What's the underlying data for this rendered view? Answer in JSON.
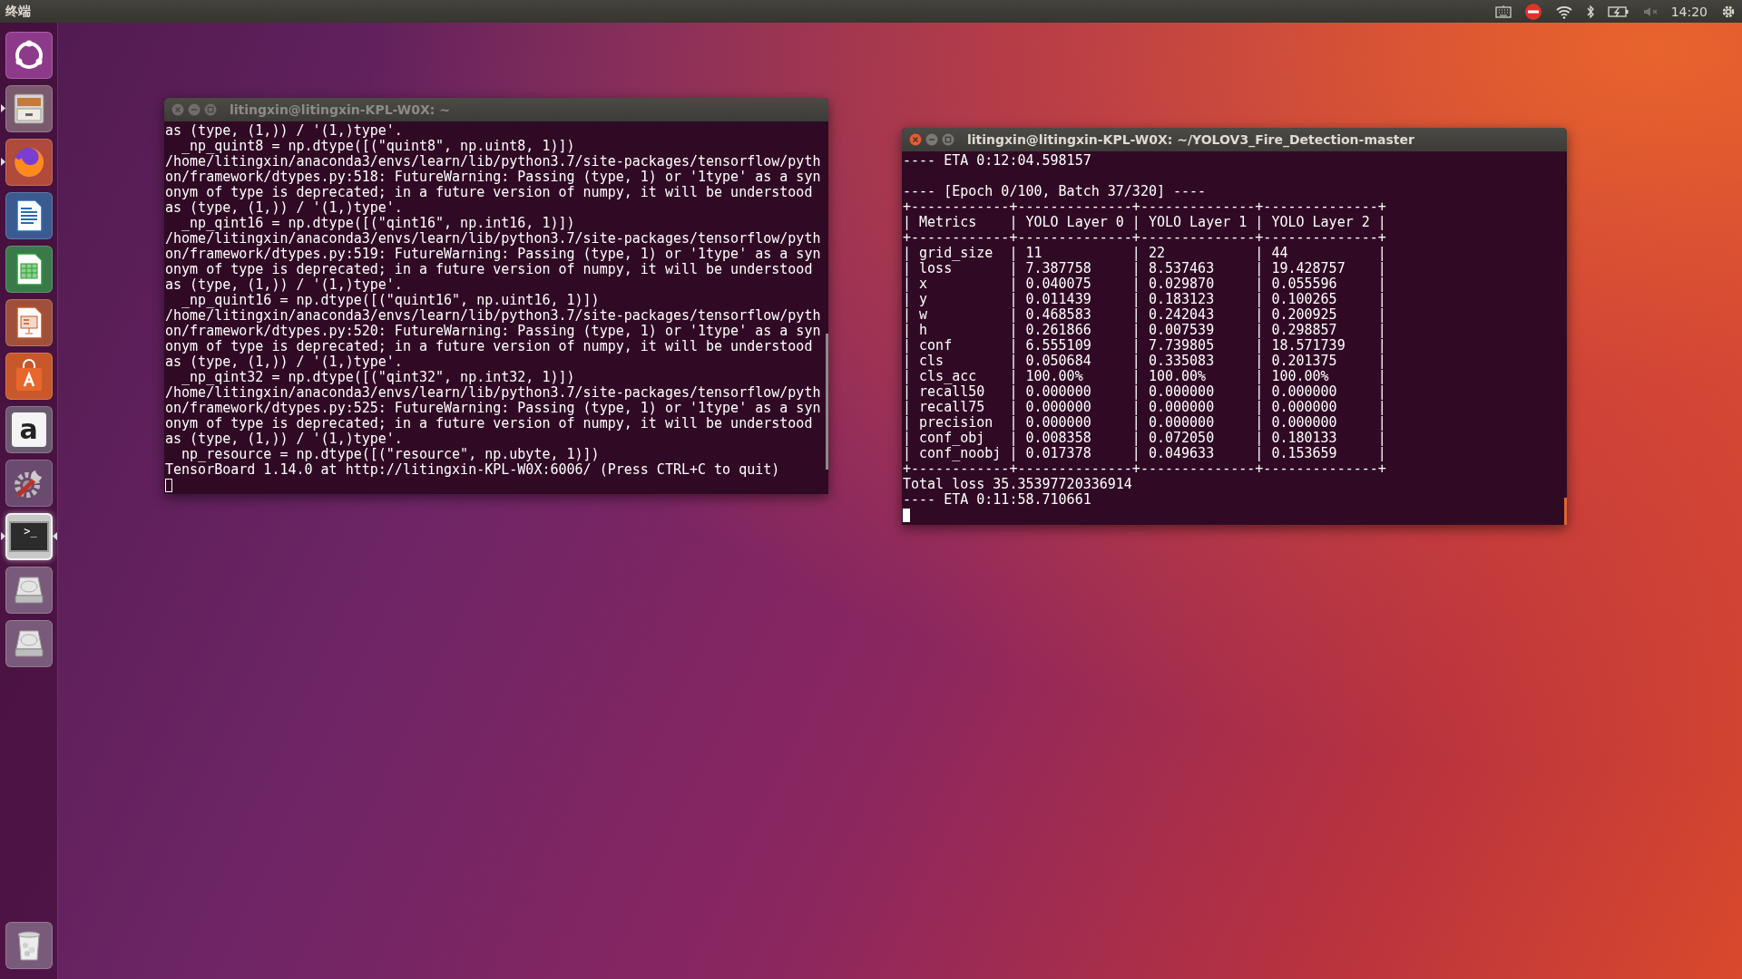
{
  "top_bar": {
    "app_title": "终端",
    "indicators": [
      {
        "kind": "keyboard"
      },
      {
        "kind": "alert"
      },
      {
        "kind": "wifi"
      },
      {
        "kind": "bluetooth"
      },
      {
        "kind": "battery"
      },
      {
        "kind": "volume-muted"
      }
    ],
    "clock": "14:20"
  },
  "launcher": {
    "items": [
      {
        "kind": "dash",
        "running": false,
        "focused": false
      },
      {
        "kind": "files",
        "running": true,
        "focused": false
      },
      {
        "kind": "browser",
        "running": true,
        "focused": false
      },
      {
        "kind": "writer",
        "running": false,
        "focused": false
      },
      {
        "kind": "calc",
        "running": false,
        "focused": false
      },
      {
        "kind": "impress",
        "running": false,
        "focused": false
      },
      {
        "kind": "software",
        "running": false,
        "focused": false
      },
      {
        "kind": "letter",
        "glyph": "a",
        "running": false,
        "focused": false
      },
      {
        "kind": "settings",
        "running": false,
        "focused": false
      },
      {
        "kind": "terminal",
        "glyph": ">_",
        "running": true,
        "focused": true
      },
      {
        "kind": "drive",
        "running": false,
        "focused": false
      },
      {
        "kind": "drive",
        "running": false,
        "focused": false
      }
    ],
    "trash": {
      "kind": "trash"
    }
  },
  "windows": [
    {
      "title": "litingxin@litingxin-KPL-W0X: ~",
      "active": false,
      "blocks": [
        [
          "as (type, (1,)) / '(1,)type'.",
          "  _np_quint8 = np.dtype([(\"quint8\", np.uint8, 1)])",
          "/home/litingxin/anaconda3/envs/learn/lib/python3.7/site-packages/tensorflow/pyth",
          "on/framework/dtypes.py:518: FutureWarning: Passing (type, 1) or '1type' as a syn",
          "onym of type is deprecated; in a future version of numpy, it will be understood",
          "as (type, (1,)) / '(1,)type'.",
          "  _np_qint16 = np.dtype([(\"qint16\", np.int16, 1)])",
          "/home/litingxin/anaconda3/envs/learn/lib/python3.7/site-packages/tensorflow/pyth",
          "on/framework/dtypes.py:519: FutureWarning: Passing (type, 1) or '1type' as a syn",
          "onym of type is deprecated; in a future version of numpy, it will be understood",
          "as (type, (1,)) / '(1,)type'.",
          "  _np_quint16 = np.dtype([(\"quint16\", np.uint16, 1)])",
          "/home/litingxin/anaconda3/envs/learn/lib/python3.7/site-packages/tensorflow/pyth",
          "on/framework/dtypes.py:520: FutureWarning: Passing (type, 1) or '1type' as a syn",
          "onym of type is deprecated; in a future version of numpy, it will be understood",
          "as (type, (1,)) / '(1,)type'.",
          "  _np_qint32 = np.dtype([(\"qint32\", np.int32, 1)])",
          "/home/litingxin/anaconda3/envs/learn/lib/python3.7/site-packages/tensorflow/pyth",
          "on/framework/dtypes.py:525: FutureWarning: Passing (type, 1) or '1type' as a syn",
          "onym of type is deprecated; in a future version of numpy, it will be understood",
          "as (type, (1,)) / '(1,)type'.",
          "  np_resource = np.dtype([(\"resource\", np.ubyte, 1)])",
          "TensorBoard 1.14.0 at http://litingxin-KPL-W0X:6006/ (Press CTRL+C to quit)"
        ]
      ]
    },
    {
      "title": "litingxin@litingxin-KPL-W0X: ~/YOLOV3_Fire_Detection-master",
      "active": true,
      "blocks": [
        [
          "---- ETA 0:12:04.598157"
        ],
        [
          "---- [Epoch 0/100, Batch 37/320] ----",
          "+------------+--------------+--------------+--------------+",
          "| Metrics    | YOLO Layer 0 | YOLO Layer 1 | YOLO Layer 2 |",
          "+------------+--------------+--------------+--------------+",
          "| grid_size  | 11           | 22           | 44           |",
          "| loss       | 7.387758     | 8.537463     | 19.428757    |",
          "| x          | 0.040075     | 0.029870     | 0.055596     |",
          "| y          | 0.011439     | 0.183123     | 0.100265     |",
          "| w          | 0.468583     | 0.242043     | 0.200925     |",
          "| h          | 0.261866     | 0.007539     | 0.298857     |",
          "| conf       | 6.555109     | 7.739805     | 18.571739    |",
          "| cls        | 0.050684     | 0.335083     | 0.201375     |",
          "| cls_acc    | 100.00%      | 100.00%      | 100.00%      |",
          "| recall50   | 0.000000     | 0.000000     | 0.000000     |",
          "| recall75   | 0.000000     | 0.000000     | 0.000000     |",
          "| precision  | 0.000000     | 0.000000     | 0.000000     |",
          "| conf_obj   | 0.008358     | 0.072050     | 0.180133     |",
          "| conf_noobj | 0.017378     | 0.049633     | 0.153659     |",
          "+------------+--------------+--------------+--------------+",
          "Total loss 35.35397720336914",
          "---- ETA 0:11:58.710661"
        ]
      ]
    }
  ]
}
